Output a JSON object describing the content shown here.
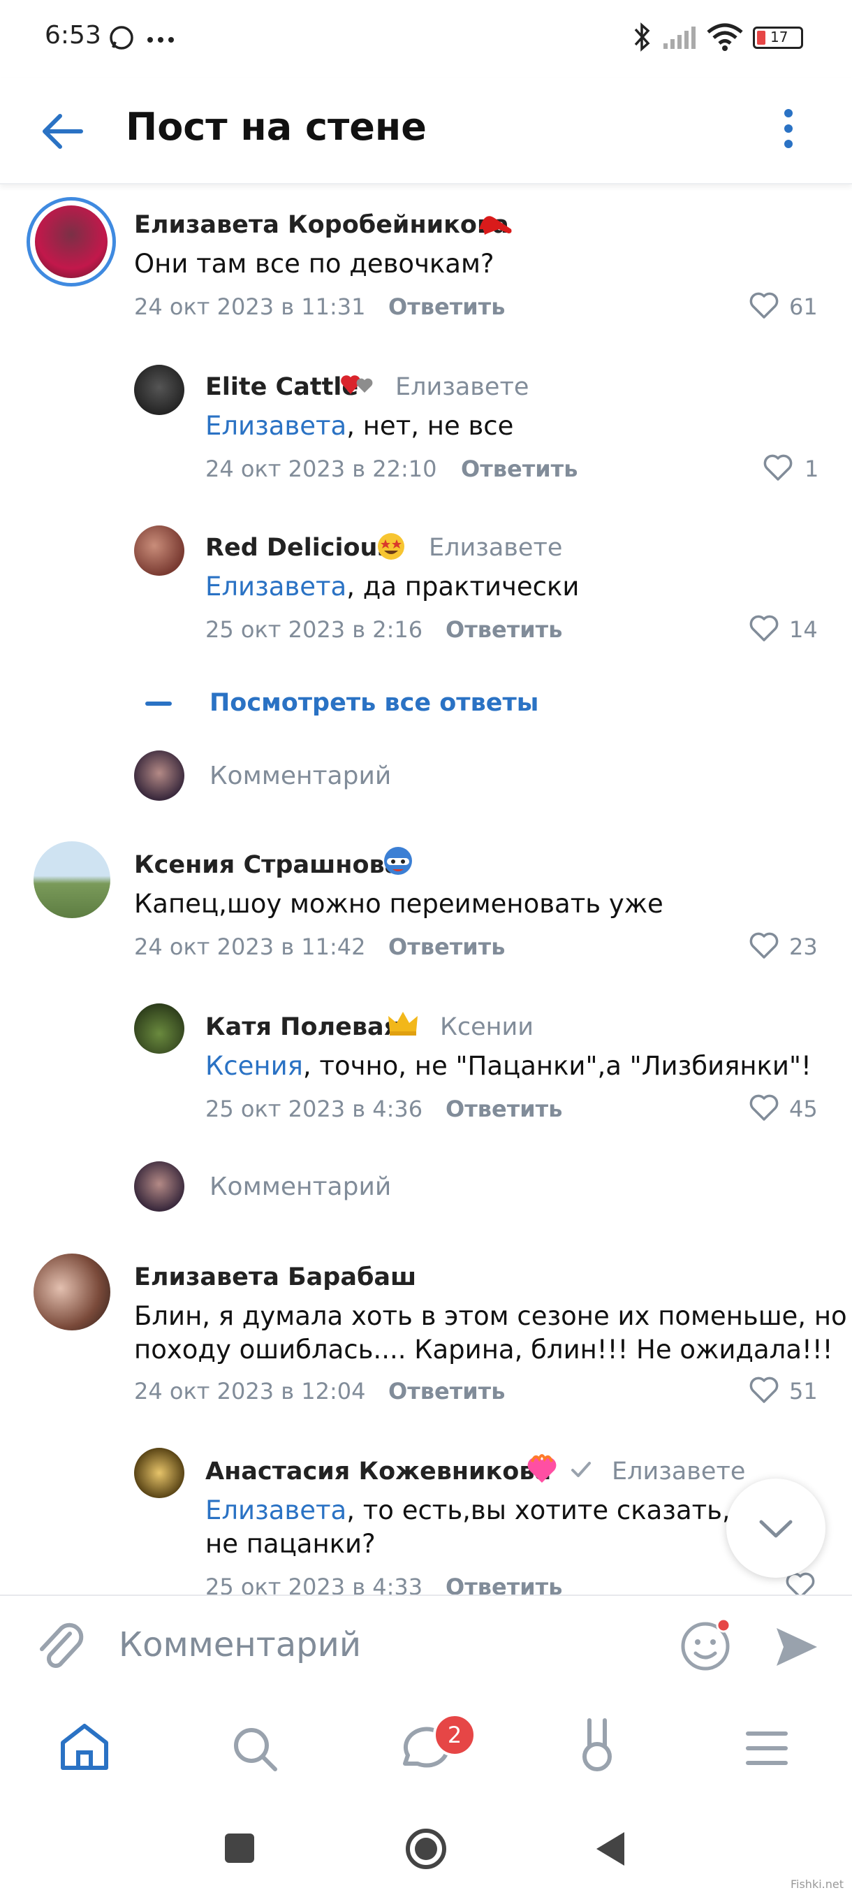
{
  "status_bar": {
    "time": "6:53",
    "battery": "17"
  },
  "header": {
    "title": "Пост на стене"
  },
  "comments": [
    {
      "name": "Елизавета Коробейникова",
      "text": "Они там все по девочкам?",
      "date": "24 окт 2023 в 11:31",
      "reply": "Ответить",
      "likes": "61"
    },
    {
      "name": "Elite Cattle",
      "to": "Елизавете",
      "mention": "Елизавета",
      "text": ", нет, не все",
      "date": "24 окт 2023 в 22:10",
      "reply": "Ответить",
      "likes": "1"
    },
    {
      "name": "Red Delicious",
      "to": "Елизавете",
      "mention": "Елизавета",
      "text": ", да практически",
      "date": "25 окт 2023 в 2:16",
      "reply": "Ответить",
      "likes": "14"
    },
    {
      "name": "Ксения Страшнова",
      "text": "Капец,шоу можно переименовать уже",
      "date": "24 окт 2023 в 11:42",
      "reply": "Ответить",
      "likes": "23"
    },
    {
      "name": "Катя Полевая",
      "to": "Ксении",
      "mention": "Ксения",
      "text": ", точно, не \"Пацанки\",а \"Лизбиянки\"!",
      "date": "25 окт 2023 в 4:36",
      "reply": "Ответить",
      "likes": "45"
    },
    {
      "name": "Елизавета Барабаш",
      "text1": "Блин, я думала хоть в этом сезоне их поменьше, но",
      "text2": "походу ошиблась.... Карина, блин!!! Не ожидала!!!",
      "date": "24 окт 2023 в 12:04",
      "reply": "Ответить",
      "likes": "51"
    },
    {
      "name": "Анастасия Кожевникова",
      "to": "Елизавете",
      "mention": "Елизавета",
      "text1": ", то есть,вы хотите сказать, чт",
      "text2": "не пацанки?",
      "date": "25 окт 2023 в 4:33",
      "reply": "Ответить"
    }
  ],
  "see_all": "Посмотреть все ответы",
  "comment_placeholder": "Комментарий",
  "input_placeholder": "Комментарий",
  "tab_badge": "2",
  "watermark": "Fishki.net",
  "colors": {
    "accent": "#2a72c4",
    "secondary_text": "#818c99",
    "badge": "#e64646"
  }
}
